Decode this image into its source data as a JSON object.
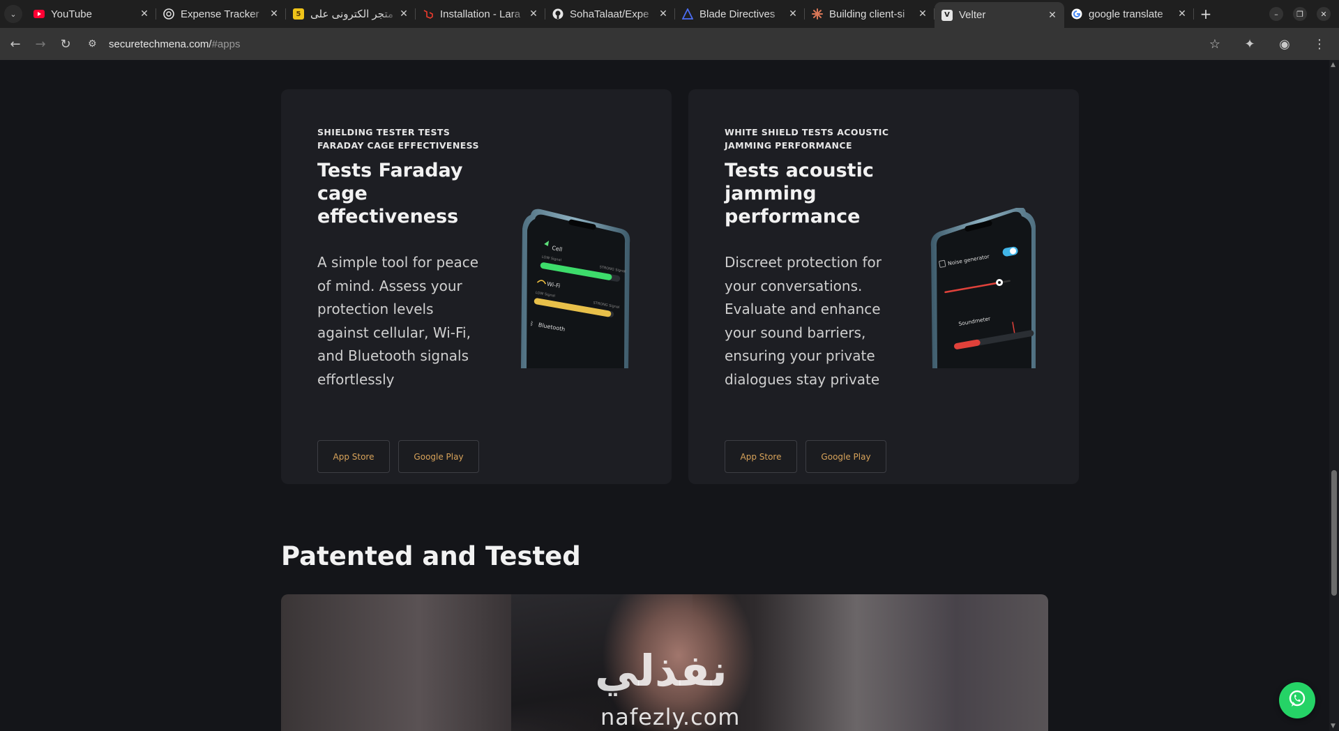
{
  "browser": {
    "tabs": [
      {
        "title": "YouTube",
        "icon": "youtube-icon",
        "color": "#ff0033"
      },
      {
        "title": "Expense Tracker",
        "icon": "openai-icon",
        "color": "#e6e6e6"
      },
      {
        "title": "متجر الكترونى على",
        "icon": "html5-icon",
        "color": "#f0c419"
      },
      {
        "title": "Installation - Lara",
        "icon": "laravel-icon",
        "color": "#ef3b2d"
      },
      {
        "title": "SohaTalaat/Expe",
        "icon": "github-icon",
        "color": "#e6e6e6"
      },
      {
        "title": "Blade Directives",
        "icon": "laracasts-icon",
        "color": "#4c6ef5"
      },
      {
        "title": "Building client-si",
        "icon": "claude-icon",
        "color": "#d97757"
      },
      {
        "title": "Velter",
        "icon": "velter-icon",
        "color": "#e6e6e6",
        "active": true
      },
      {
        "title": "google translate",
        "icon": "google-icon",
        "color": "#4285f4"
      }
    ],
    "url_host": "securetechmena.com/",
    "url_path": "#apps"
  },
  "page": {
    "cards": [
      {
        "eyebrow": "SHIELDING TESTER TESTS FARADAY CAGE EFFECTIVENESS",
        "headline": "Tests Faraday cage effectiveness",
        "body": "A simple tool for peace of mind. Assess your protection levels against cellular, Wi-Fi, and Bluetooth signals effortlessly",
        "app_store": "App Store",
        "google_play": "Google Play",
        "phone": {
          "row1_label": "Cell",
          "row2_label": "Wi-Fi",
          "row3_label": "Bluetooth",
          "sublabel": "LOW Signal",
          "strong_label": "STRONG Signal"
        }
      },
      {
        "eyebrow": "WHITE SHIELD TESTS ACOUSTIC JAMMING PERFORMANCE",
        "headline": "Tests acoustic jamming performance",
        "body": "Discreet protection for your conversations. Evaluate and enhance your sound barriers, ensuring your private dialogues stay private",
        "app_store": "App Store",
        "google_play": "Google Play",
        "phone": {
          "row1_label": "Noise generator",
          "row2_label": "Soundmeter"
        }
      }
    ],
    "section_title": "Patented and Tested",
    "watermark_ar": "نفذلي",
    "watermark_lat": "nafezly.com"
  },
  "colors": {
    "accent_button_text": "#d8a35a",
    "page_bg": "#141519",
    "card_bg": "#1d1e23",
    "whatsapp": "#25d366"
  }
}
